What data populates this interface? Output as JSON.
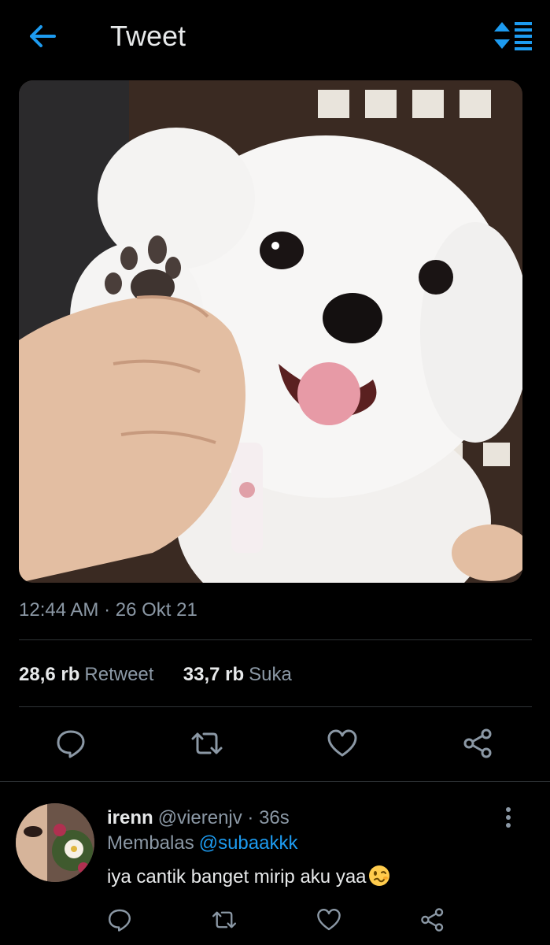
{
  "header": {
    "title": "Tweet",
    "back_icon": "arrow-left-icon",
    "sort_icon": "sort-icon",
    "accent": "#1d9bf0"
  },
  "tweet": {
    "image_alt": "white puppy",
    "timestamp": "12:44 AM · 26 Okt 21",
    "retweet_count": "28,6 rb",
    "retweet_label": "Retweet",
    "like_count": "33,7 rb",
    "like_label": "Suka",
    "actions": [
      "reply-icon",
      "retweet-icon",
      "heart-icon",
      "share-icon"
    ]
  },
  "reply": {
    "name": "irenn",
    "handle": "@vierenjv · 36s",
    "replying_label": "Membalas",
    "replying_to": "@subaakkk",
    "text": "iya cantik banget mirip aku yaa",
    "emoji": "woozy-face-emoji",
    "actions": [
      "reply-icon",
      "retweet-icon",
      "heart-icon",
      "share-icon"
    ],
    "more_icon": "more-vertical-icon"
  },
  "colors": {
    "background": "#000000",
    "text": "#e7e9ea",
    "secondary": "#8b98a5",
    "divider": "#2f3336",
    "link": "#1d9bf0"
  }
}
